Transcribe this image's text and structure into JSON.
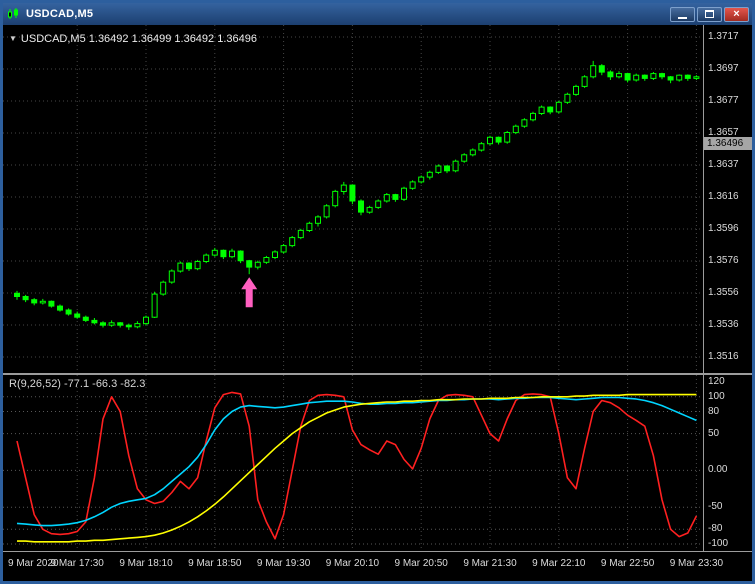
{
  "window": {
    "title": "USDCAD,M5",
    "controls": {
      "minimize": "minimize",
      "maximize": "maximize",
      "close_glyph": "×"
    }
  },
  "chart": {
    "header": {
      "marker": "▼",
      "text": "USDCAD,M5 1.36492 1.36499 1.36492 1.36496"
    },
    "price_axis": {
      "labels": [
        "1.3717",
        "1.3697",
        "1.3677",
        "1.3657",
        "1.3637",
        "1.3616",
        "1.3596",
        "1.3576",
        "1.3556",
        "1.3536",
        "1.3516"
      ],
      "current_price": "1.36496"
    },
    "colors": {
      "background": "#000000",
      "grid": "#464646",
      "candle": "#00FF00",
      "bull_fill": "#000000",
      "price_tag_bg": "#A6A6A6",
      "arrow": "#FF5FC0"
    }
  },
  "indicator": {
    "label": "R(9,26,52) -77.1 -66.3 -82.3",
    "axis_labels": [
      {
        "text": "120",
        "value": 120
      },
      {
        "text": "100",
        "value": 100
      },
      {
        "text": "80",
        "value": 80
      },
      {
        "text": "50",
        "value": 50
      },
      {
        "text": "0.00",
        "value": 0
      },
      {
        "text": "-50",
        "value": -50
      },
      {
        "text": "-80",
        "value": -80
      },
      {
        "text": "-100",
        "value": -100
      }
    ],
    "levels": [
      100,
      80,
      50,
      0,
      -50,
      -80,
      -100
    ]
  },
  "time_axis": {
    "labels": [
      "9 Mar 2020",
      "9 Mar 17:30",
      "9 Mar 18:10",
      "9 Mar 18:50",
      "9 Mar 19:30",
      "9 Mar 20:10",
      "9 Mar 20:50",
      "9 Mar 21:30",
      "9 Mar 22:10",
      "9 Mar 22:50",
      "9 Mar 23:30"
    ]
  },
  "chart_data": {
    "type": "candlestick",
    "symbol": "USDCAD",
    "timeframe": "M5",
    "ohlc_current": {
      "open": 1.36492,
      "high": 1.36499,
      "low": 1.36492,
      "close": 1.36496
    },
    "price_base": 1.35,
    "pip": 0.0001,
    "candles_ohlc_pips": [
      [
        56,
        57.5,
        52,
        54
      ],
      [
        54,
        55,
        50.5,
        52
      ],
      [
        52,
        53,
        48.5,
        50
      ],
      [
        50,
        52.5,
        49,
        51
      ],
      [
        51,
        51.5,
        47,
        48
      ],
      [
        48,
        49,
        44.5,
        45.5
      ],
      [
        45.5,
        46.5,
        42,
        43
      ],
      [
        43,
        44.5,
        40,
        41
      ],
      [
        41,
        42,
        38,
        39
      ],
      [
        39,
        40.5,
        36.5,
        37.5
      ],
      [
        37.5,
        38.5,
        34.5,
        36
      ],
      [
        36,
        39,
        35,
        37.5
      ],
      [
        37.5,
        38,
        34.5,
        36
      ],
      [
        36,
        37,
        33,
        35
      ],
      [
        35,
        38.5,
        34,
        37
      ],
      [
        37,
        42,
        36,
        41
      ],
      [
        41,
        57,
        40.5,
        55.5
      ],
      [
        55.5,
        64,
        54.5,
        63
      ],
      [
        63,
        71,
        62,
        70
      ],
      [
        70,
        76,
        69,
        75
      ],
      [
        75,
        75.5,
        70,
        71.5
      ],
      [
        71.5,
        77,
        70.5,
        76
      ],
      [
        76,
        81,
        75,
        80
      ],
      [
        80,
        84.5,
        79,
        83
      ],
      [
        83,
        83.5,
        77.5,
        79
      ],
      [
        79,
        84,
        78,
        82.5
      ],
      [
        82.5,
        83,
        75,
        76.5
      ],
      [
        76.5,
        77,
        68,
        72.5
      ],
      [
        72.5,
        76.5,
        71,
        75.5
      ],
      [
        75.5,
        79.5,
        74.5,
        78.5
      ],
      [
        78.5,
        83,
        77.5,
        82
      ],
      [
        82,
        87,
        81,
        86
      ],
      [
        86,
        92,
        85,
        91
      ],
      [
        91,
        96.5,
        90,
        95.5
      ],
      [
        95.5,
        101,
        94.5,
        100
      ],
      [
        100,
        105,
        98,
        104
      ],
      [
        104,
        112,
        103,
        111
      ],
      [
        111,
        121,
        110,
        120
      ],
      [
        120,
        126,
        118,
        124
      ],
      [
        124,
        124.5,
        112,
        114
      ],
      [
        114,
        115,
        105,
        107
      ],
      [
        107,
        111,
        106,
        110
      ],
      [
        110,
        115,
        109,
        114
      ],
      [
        114,
        119,
        113,
        118
      ],
      [
        118,
        118.5,
        113.5,
        115
      ],
      [
        115,
        123,
        114,
        122
      ],
      [
        122,
        127,
        121,
        126
      ],
      [
        126,
        130,
        125,
        129
      ],
      [
        129,
        133,
        127.5,
        132
      ],
      [
        132,
        137,
        131,
        136
      ],
      [
        136,
        136.5,
        131.5,
        133
      ],
      [
        133,
        140,
        132,
        139
      ],
      [
        139,
        144,
        138,
        143
      ],
      [
        143,
        147,
        142,
        146
      ],
      [
        146,
        151,
        145,
        150
      ],
      [
        150,
        155,
        149,
        154
      ],
      [
        154,
        154.5,
        149.5,
        151
      ],
      [
        151,
        158,
        150,
        157
      ],
      [
        157,
        162,
        156,
        161
      ],
      [
        161,
        166,
        160,
        165
      ],
      [
        165,
        170,
        164,
        169
      ],
      [
        169,
        174,
        168,
        173
      ],
      [
        173,
        173.5,
        168.5,
        170
      ],
      [
        170,
        177,
        169,
        176
      ],
      [
        176,
        182,
        175,
        181
      ],
      [
        181,
        187,
        180,
        186
      ],
      [
        186,
        193,
        185,
        192
      ],
      [
        192,
        202,
        191,
        199
      ],
      [
        199,
        200,
        193,
        195
      ],
      [
        195,
        196,
        190,
        192
      ],
      [
        192,
        195.5,
        191,
        194
      ],
      [
        194,
        194.5,
        188.5,
        190
      ],
      [
        190,
        194,
        189,
        193
      ],
      [
        193,
        193.5,
        189.5,
        191
      ],
      [
        191,
        195,
        190,
        194
      ],
      [
        194,
        194.5,
        190.5,
        192
      ],
      [
        192,
        192.5,
        188,
        190
      ],
      [
        190,
        193.5,
        189,
        193
      ],
      [
        193,
        193.5,
        189.5,
        191
      ],
      [
        191,
        193,
        190,
        192
      ]
    ],
    "indicator": {
      "name": "R(9,26,52)",
      "range": [
        -110,
        130
      ],
      "series": [
        {
          "name": "r-fast",
          "color": "#FF2020",
          "values": [
            40,
            -10,
            -60,
            -80,
            -86,
            -87,
            -86,
            -83,
            -70,
            -10,
            70,
            100,
            80,
            20,
            -25,
            -40,
            -45,
            -42,
            -30,
            -15,
            -25,
            -10,
            40,
            85,
            103,
            106,
            104,
            60,
            -40,
            -70,
            -93,
            -60,
            0,
            60,
            95,
            102,
            103,
            102,
            100,
            55,
            35,
            28,
            22,
            40,
            35,
            15,
            2,
            30,
            70,
            95,
            102,
            103,
            102,
            100,
            75,
            50,
            40,
            70,
            95,
            103,
            104,
            103,
            100,
            50,
            -10,
            -25,
            30,
            80,
            95,
            92,
            85,
            75,
            68,
            60,
            20,
            -40,
            -80,
            -90,
            -85,
            -62
          ]
        },
        {
          "name": "r-medium",
          "color": "#00D5FF",
          "values": [
            -72,
            -73,
            -74,
            -75,
            -75,
            -74,
            -73,
            -71,
            -68,
            -63,
            -57,
            -50,
            -45,
            -42,
            -40,
            -38,
            -33,
            -25,
            -15,
            -5,
            5,
            18,
            35,
            55,
            70,
            80,
            86,
            88,
            87,
            86,
            85,
            86,
            88,
            90,
            92,
            93,
            94,
            94,
            94,
            93,
            91,
            90,
            90,
            91,
            91,
            92,
            92,
            93,
            94,
            95,
            95,
            96,
            96,
            97,
            97,
            97,
            96,
            97,
            98,
            98,
            99,
            99,
            99,
            98,
            97,
            96,
            97,
            98,
            99,
            99,
            99,
            98,
            97,
            95,
            92,
            88,
            83,
            78,
            73,
            68
          ]
        },
        {
          "name": "r-slow",
          "color": "#FFFF00",
          "values": [
            -96,
            -96,
            -97,
            -97,
            -97,
            -97,
            -97,
            -96,
            -96,
            -95,
            -95,
            -94,
            -93,
            -92,
            -91,
            -90,
            -88,
            -85,
            -81,
            -76,
            -70,
            -63,
            -55,
            -46,
            -36,
            -25,
            -14,
            -3,
            8,
            19,
            30,
            40,
            50,
            58,
            66,
            72,
            78,
            82,
            86,
            88,
            90,
            91,
            92,
            93,
            93,
            94,
            94,
            95,
            95,
            96,
            96,
            96,
            97,
            97,
            97,
            98,
            98,
            98,
            99,
            99,
            99,
            100,
            100,
            100,
            100,
            101,
            101,
            102,
            102,
            102,
            102,
            103,
            103,
            103,
            103,
            103,
            103,
            103,
            103,
            103
          ]
        }
      ]
    },
    "signal_arrow": {
      "candle_index": 27,
      "direction": "up",
      "color": "#FF5FC0"
    }
  }
}
